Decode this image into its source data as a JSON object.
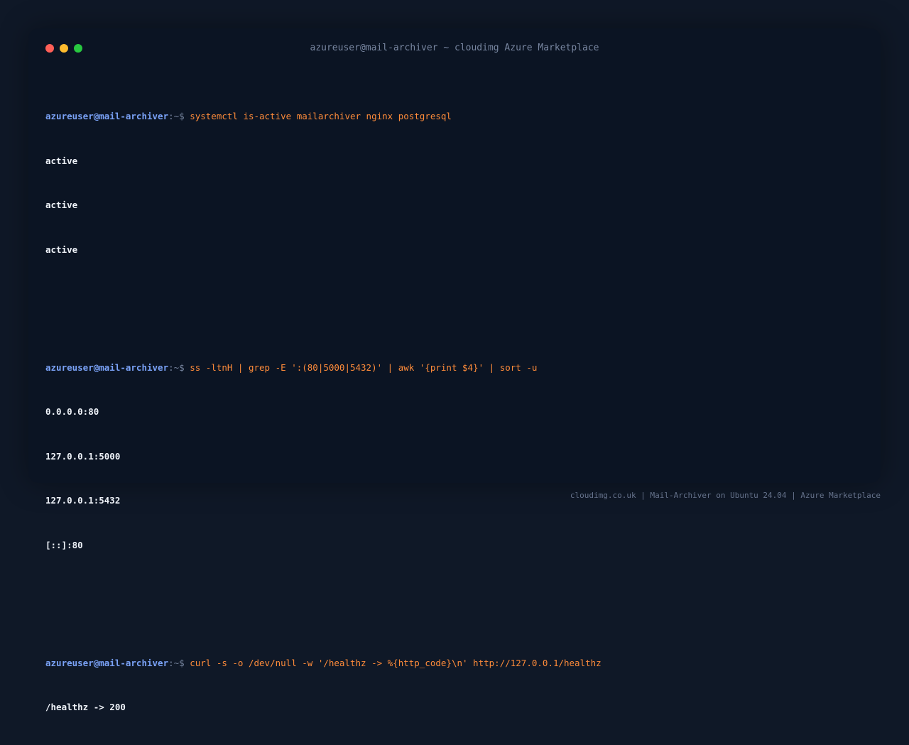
{
  "window": {
    "title": "azureuser@mail-archiver ~ cloudimg Azure Marketplace",
    "buttons": {
      "close": "#ff5f57",
      "minimize": "#febc2e",
      "maximize": "#28c840"
    }
  },
  "prompt": {
    "user_host": "azureuser@mail-archiver",
    "suffix": ":~$ "
  },
  "blocks": [
    {
      "command": "systemctl is-active mailarchiver nginx postgresql",
      "output": [
        "active",
        "active",
        "active"
      ]
    },
    {
      "command": "ss -ltnH | grep -E ':(80|5000|5432)' | awk '{print $4}' | sort -u",
      "output": [
        "0.0.0.0:80",
        "127.0.0.1:5000",
        "127.0.0.1:5432",
        "[::]:80"
      ]
    },
    {
      "command": "curl -s -o /dev/null -w '/healthz -> %{http_code}\\n' http://127.0.0.1/healthz",
      "output": [
        "/healthz -> 200"
      ]
    }
  ],
  "footer": {
    "text": "cloudimg.co.uk | Mail-Archiver on Ubuntu 24.04 | Azure Marketplace"
  },
  "colors": {
    "background": "#0f1827",
    "terminal": "#0b1423",
    "prompt": "#7aa2f7",
    "command": "#ff8c3a",
    "output": "#eef2f8"
  }
}
